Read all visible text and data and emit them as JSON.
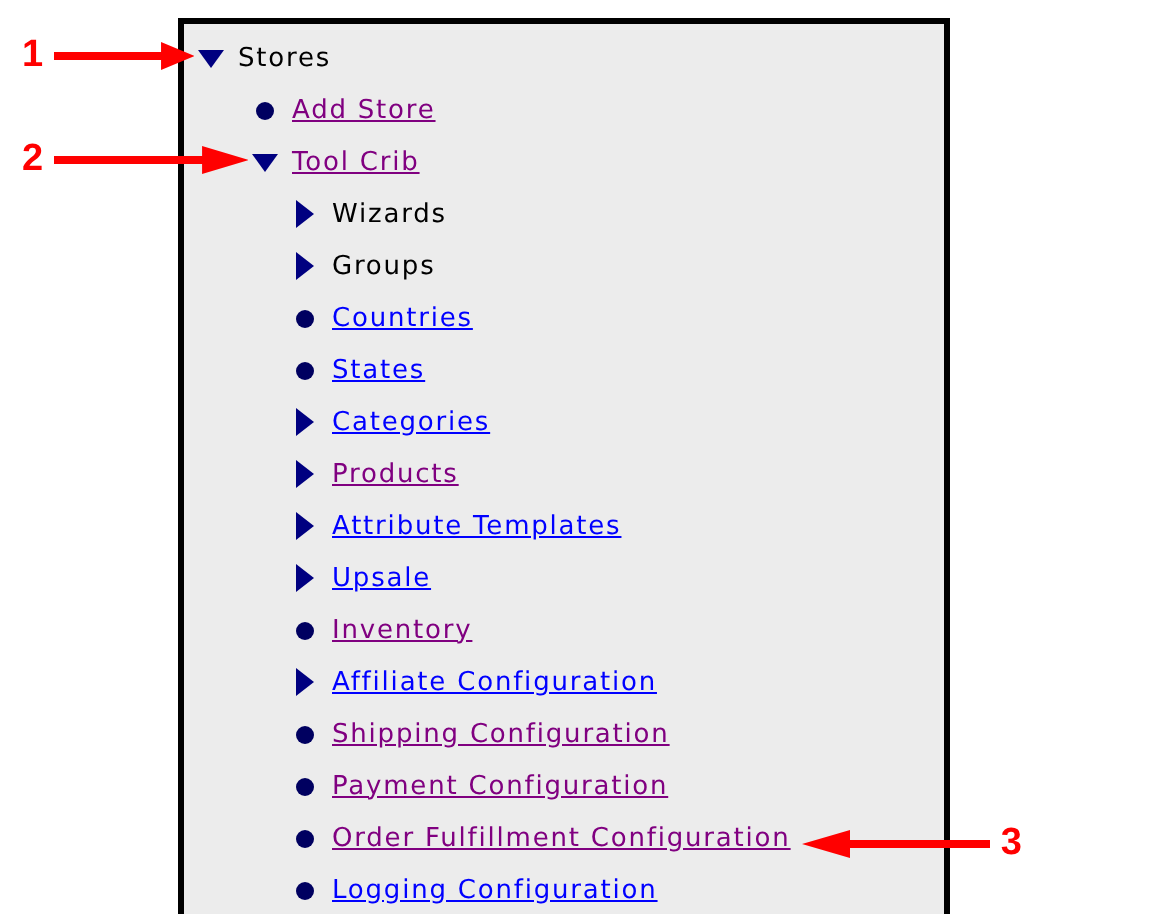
{
  "tree": [
    {
      "label": "Stores",
      "kind": "expanded",
      "is_link": false,
      "callout": {
        "label": "1",
        "on_right": false
      },
      "children": [
        {
          "label": "Add Store",
          "kind": "leaf",
          "is_link": true,
          "visited": true
        },
        {
          "label": "Tool Crib",
          "kind": "expanded",
          "is_link": true,
          "visited": true,
          "callout": {
            "label": "2",
            "on_right": false
          },
          "children": [
            {
              "label": "Wizards",
              "kind": "collapsed",
              "is_link": false
            },
            {
              "label": "Groups",
              "kind": "collapsed",
              "is_link": false
            },
            {
              "label": "Countries",
              "kind": "leaf",
              "is_link": true,
              "visited": false
            },
            {
              "label": "States",
              "kind": "leaf",
              "is_link": true,
              "visited": false
            },
            {
              "label": "Categories",
              "kind": "collapsed",
              "is_link": true,
              "visited": false
            },
            {
              "label": "Products",
              "kind": "collapsed",
              "is_link": true,
              "visited": true
            },
            {
              "label": "Attribute Templates",
              "kind": "collapsed",
              "is_link": true,
              "visited": false
            },
            {
              "label": "Upsale",
              "kind": "collapsed",
              "is_link": true,
              "visited": false
            },
            {
              "label": "Inventory",
              "kind": "leaf",
              "is_link": true,
              "visited": true
            },
            {
              "label": "Affiliate Configuration",
              "kind": "collapsed",
              "is_link": true,
              "visited": false
            },
            {
              "label": "Shipping Configuration",
              "kind": "leaf",
              "is_link": true,
              "visited": true
            },
            {
              "label": "Payment Configuration",
              "kind": "leaf",
              "is_link": true,
              "visited": true
            },
            {
              "label": "Order Fulfillment Configuration",
              "kind": "leaf",
              "is_link": true,
              "visited": true,
              "callout": {
                "label": "3",
                "on_right": true
              }
            },
            {
              "label": "Logging Configuration",
              "kind": "leaf",
              "is_link": true,
              "visited": false
            }
          ]
        }
      ]
    }
  ]
}
